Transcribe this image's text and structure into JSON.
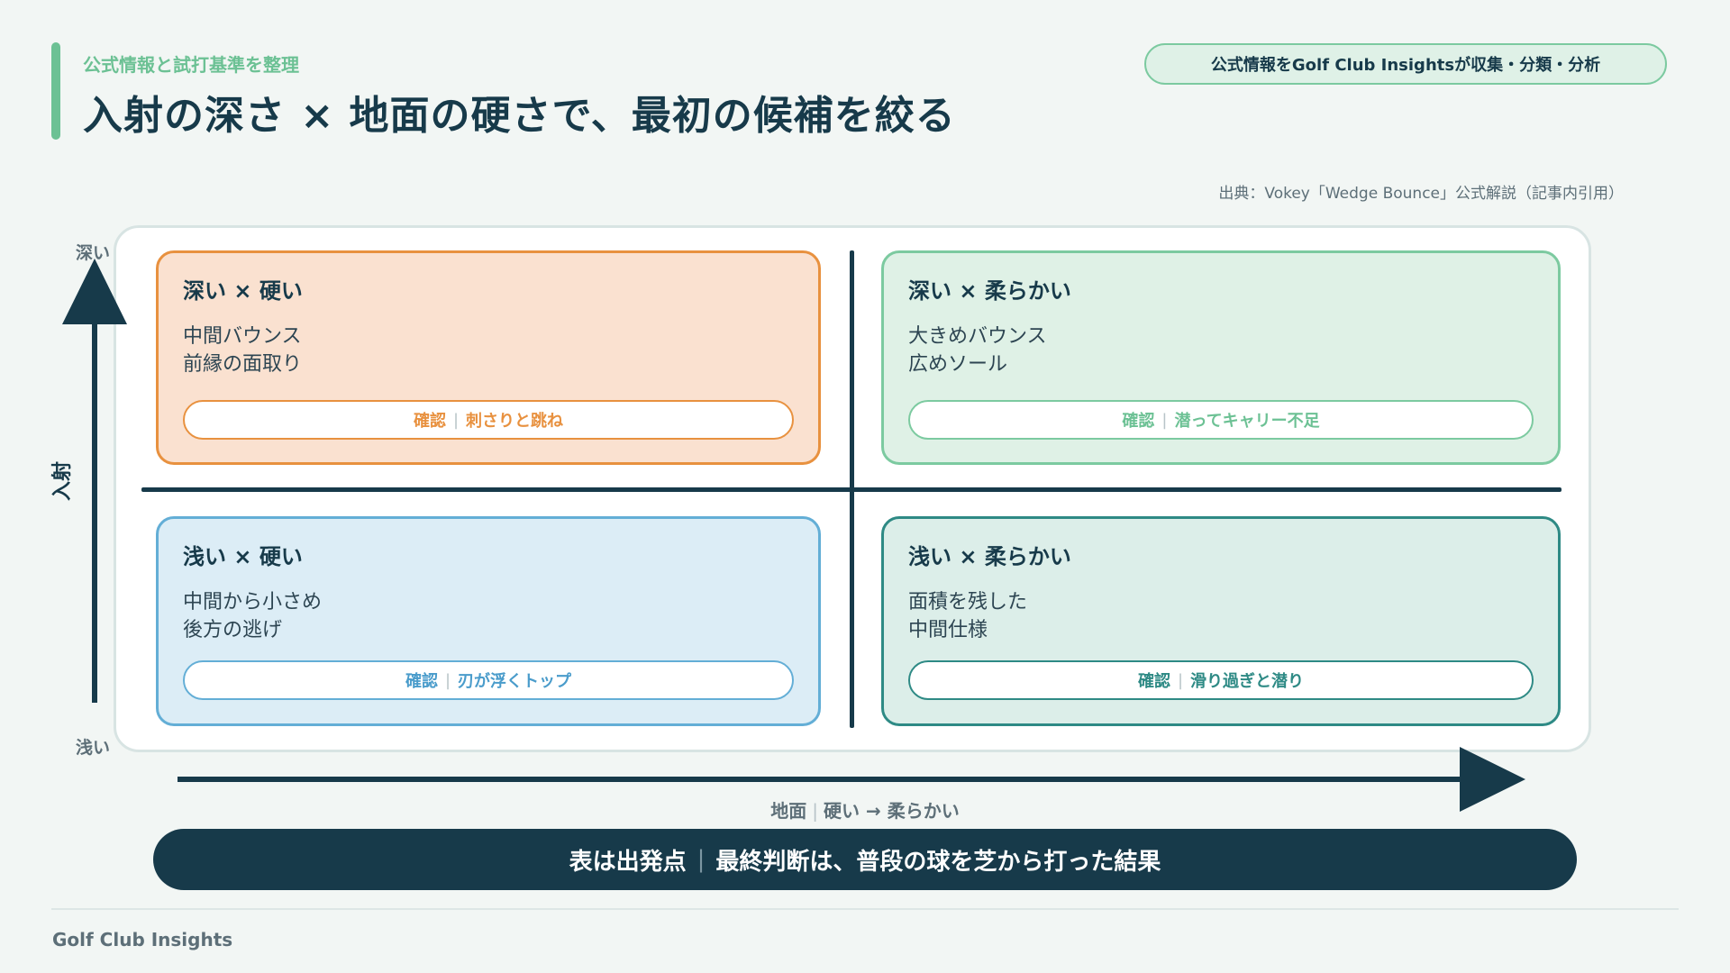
{
  "header": {
    "kicker": "公式情報と試打基準を整理",
    "title": "入射の深さ × 地面の硬さで、最初の候補を絞る",
    "badge": "公式情報をGolf Club Insightsが収集・分類・分析"
  },
  "source": "出典：Vokey「Wedge Bounce」公式解説（記事内引用）",
  "axes": {
    "y_title": "入射",
    "y_top": "深い",
    "y_bottom": "浅い",
    "x_part1": "地面",
    "x_part2": "硬い → 柔らかい"
  },
  "quadrants": {
    "top_left": {
      "title": "深い × 硬い",
      "line1": "中間バウンス",
      "line2": "前縁の面取り",
      "check_label": "確認",
      "check_value": "刺さりと跳ね",
      "color": "#e8913f"
    },
    "top_right": {
      "title": "深い × 柔らかい",
      "line1": "大きめバウンス",
      "line2": "広めソール",
      "check_label": "確認",
      "check_value": "潜ってキャリー不足",
      "color": "#7ccaa0"
    },
    "bottom_left": {
      "title": "浅い × 硬い",
      "line1": "中間から小さめ",
      "line2": "後方の逃げ",
      "check_label": "確認",
      "check_value": "刃が浮くトップ",
      "color": "#63aed6"
    },
    "bottom_right": {
      "title": "浅い × 柔らかい",
      "line1": "面積を残した",
      "line2": "中間仕様",
      "check_label": "確認",
      "check_value": "滑り過ぎと潜り",
      "color": "#2e8a85"
    }
  },
  "banner": {
    "part1": "表は出発点",
    "part2": "最終判断は、普段の球を芝から打った結果"
  },
  "footer": {
    "brand": "Golf Club Insights"
  }
}
